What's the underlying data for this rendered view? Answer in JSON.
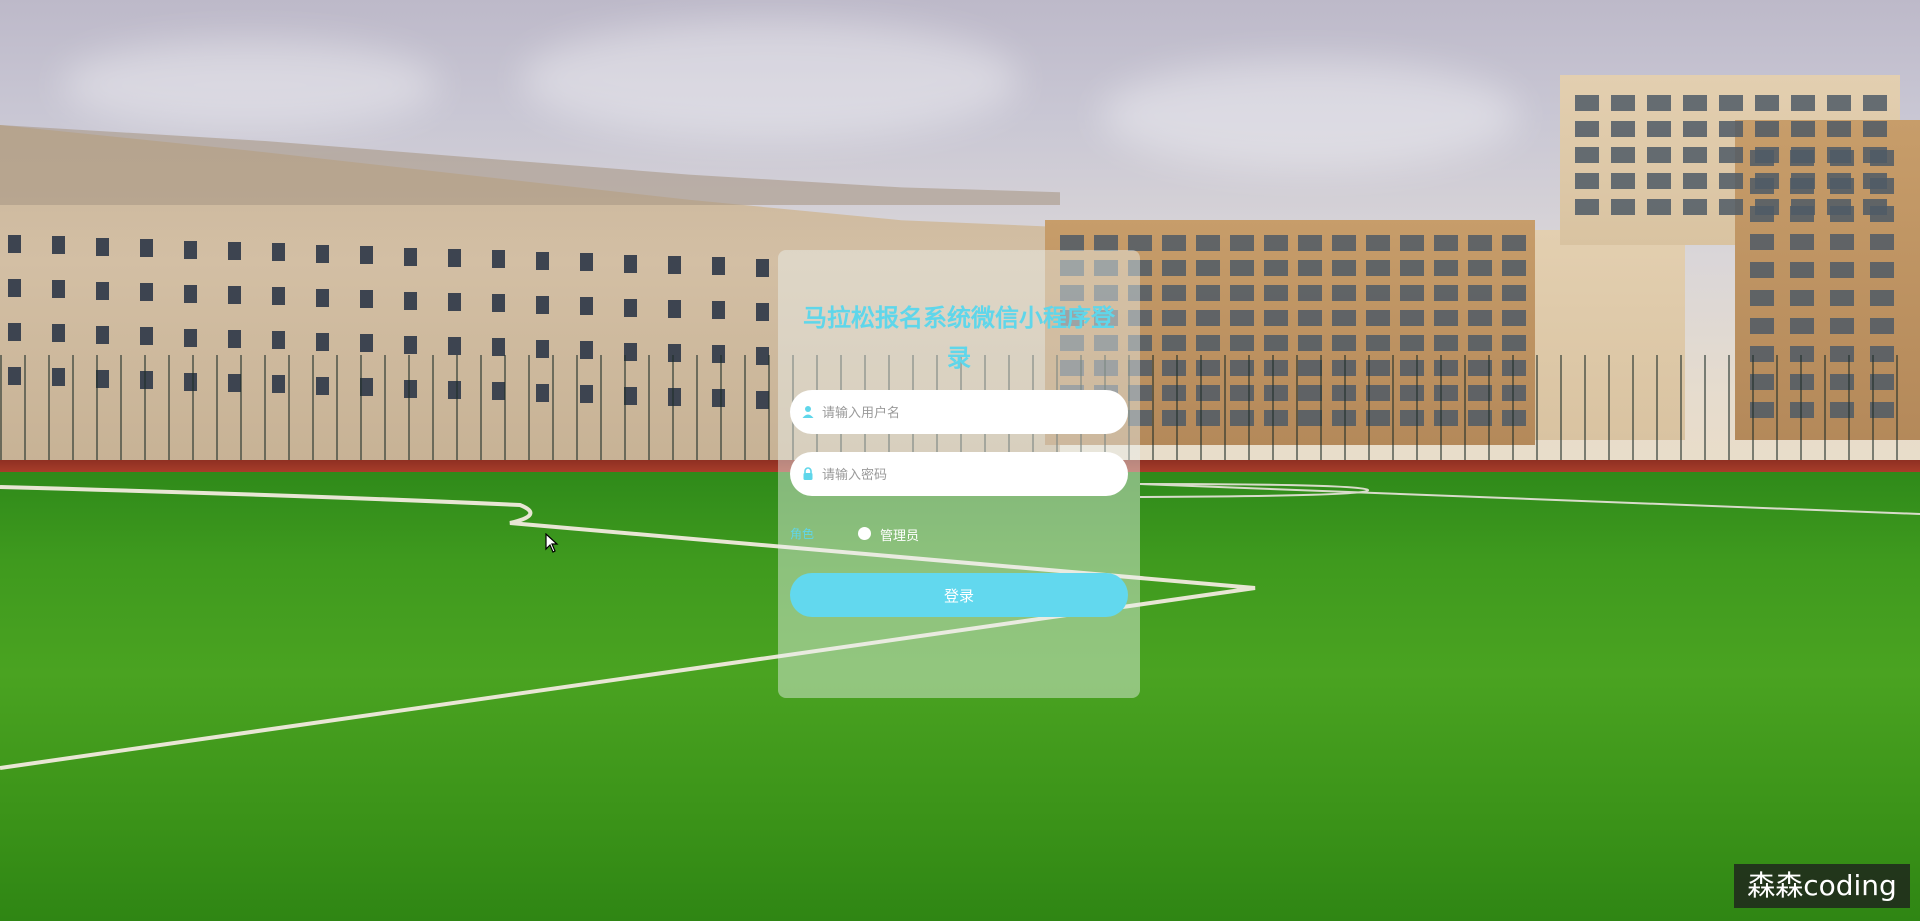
{
  "login": {
    "title": "马拉松报名系统微信小程序登录",
    "username_placeholder": "请输入用户名",
    "password_placeholder": "请输入密码",
    "role_label": "角色",
    "role_options": [
      "管理员"
    ],
    "role_selected": "管理员",
    "submit_label": "登录"
  },
  "icons": {
    "username": "user-icon",
    "password": "lock-icon"
  },
  "colors": {
    "accent": "#5fd6ea",
    "button": "#62d8ee",
    "card": "rgba(235,242,240,0.45)"
  },
  "watermark": {
    "text": "森森coding"
  }
}
